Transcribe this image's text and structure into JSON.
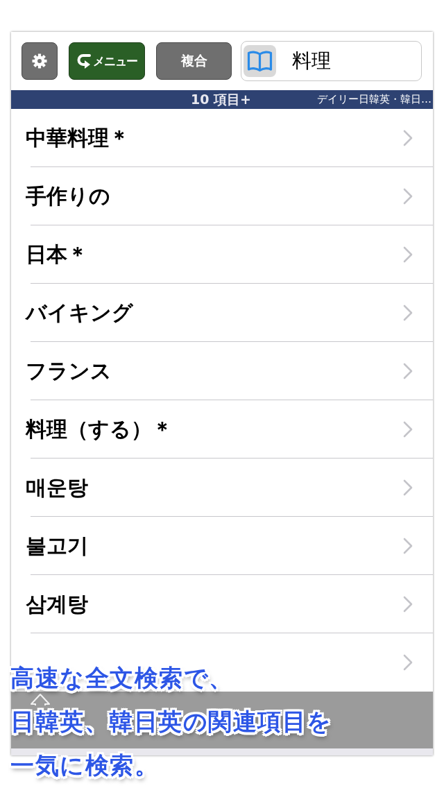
{
  "toolbar": {
    "buttons": [
      {
        "kind": "settings"
      },
      {
        "kind": "menu",
        "label": "メニュー"
      },
      {
        "kind": "plain",
        "label": "複合"
      }
    ],
    "search": {
      "value": "料理"
    }
  },
  "status_bar": {
    "count": "10 項目+",
    "dictionary": "デイリー日韓英・韓日…"
  },
  "results": [
    {
      "kind": "entry",
      "label": "中華料理＊"
    },
    {
      "kind": "entry",
      "label": "手作りの"
    },
    {
      "kind": "entry",
      "label": "日本＊"
    },
    {
      "kind": "entry",
      "label": "バイキング"
    },
    {
      "kind": "entry",
      "label": "フランス"
    },
    {
      "kind": "entry",
      "label": "料理（する）＊"
    },
    {
      "kind": "entry",
      "label": "매운탕"
    },
    {
      "kind": "entry",
      "label": "불고기"
    },
    {
      "kind": "entry",
      "label": "삼계탕"
    },
    {
      "kind": "covered"
    }
  ],
  "caption": {
    "lines": [
      "高速な全文検索で、",
      "日韓英、韓日英の関連項目を",
      "一気に検索。"
    ]
  }
}
